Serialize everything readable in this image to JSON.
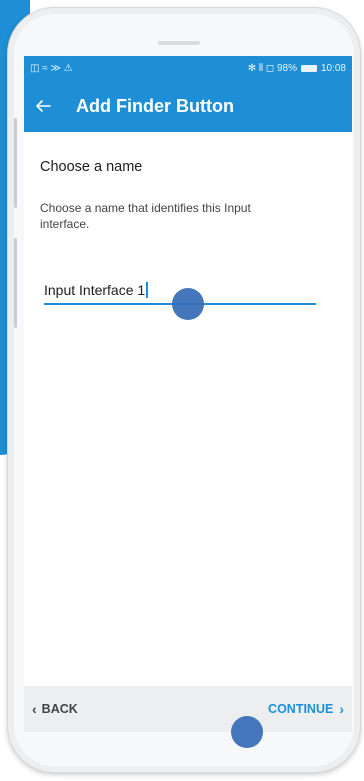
{
  "status_bar": {
    "left_icons": "◫ ≈ ≫ ⚠",
    "bluetooth_icon": "bluetooth-icon",
    "right_text": "✻ ⫴ ◻ 98%",
    "time": "10:08"
  },
  "app_bar": {
    "back_icon": "arrow-left-icon",
    "title": "Add Finder Button"
  },
  "form": {
    "heading": "Choose a name",
    "description": "Choose a name that identifies this Input interface.",
    "name_value": "Input Interface 1"
  },
  "bottom_bar": {
    "back_label": "BACK",
    "continue_label": "CONTINUE"
  },
  "colors": {
    "accent": "#1e8fd6",
    "tap_indicator": "#3a6fb7"
  }
}
